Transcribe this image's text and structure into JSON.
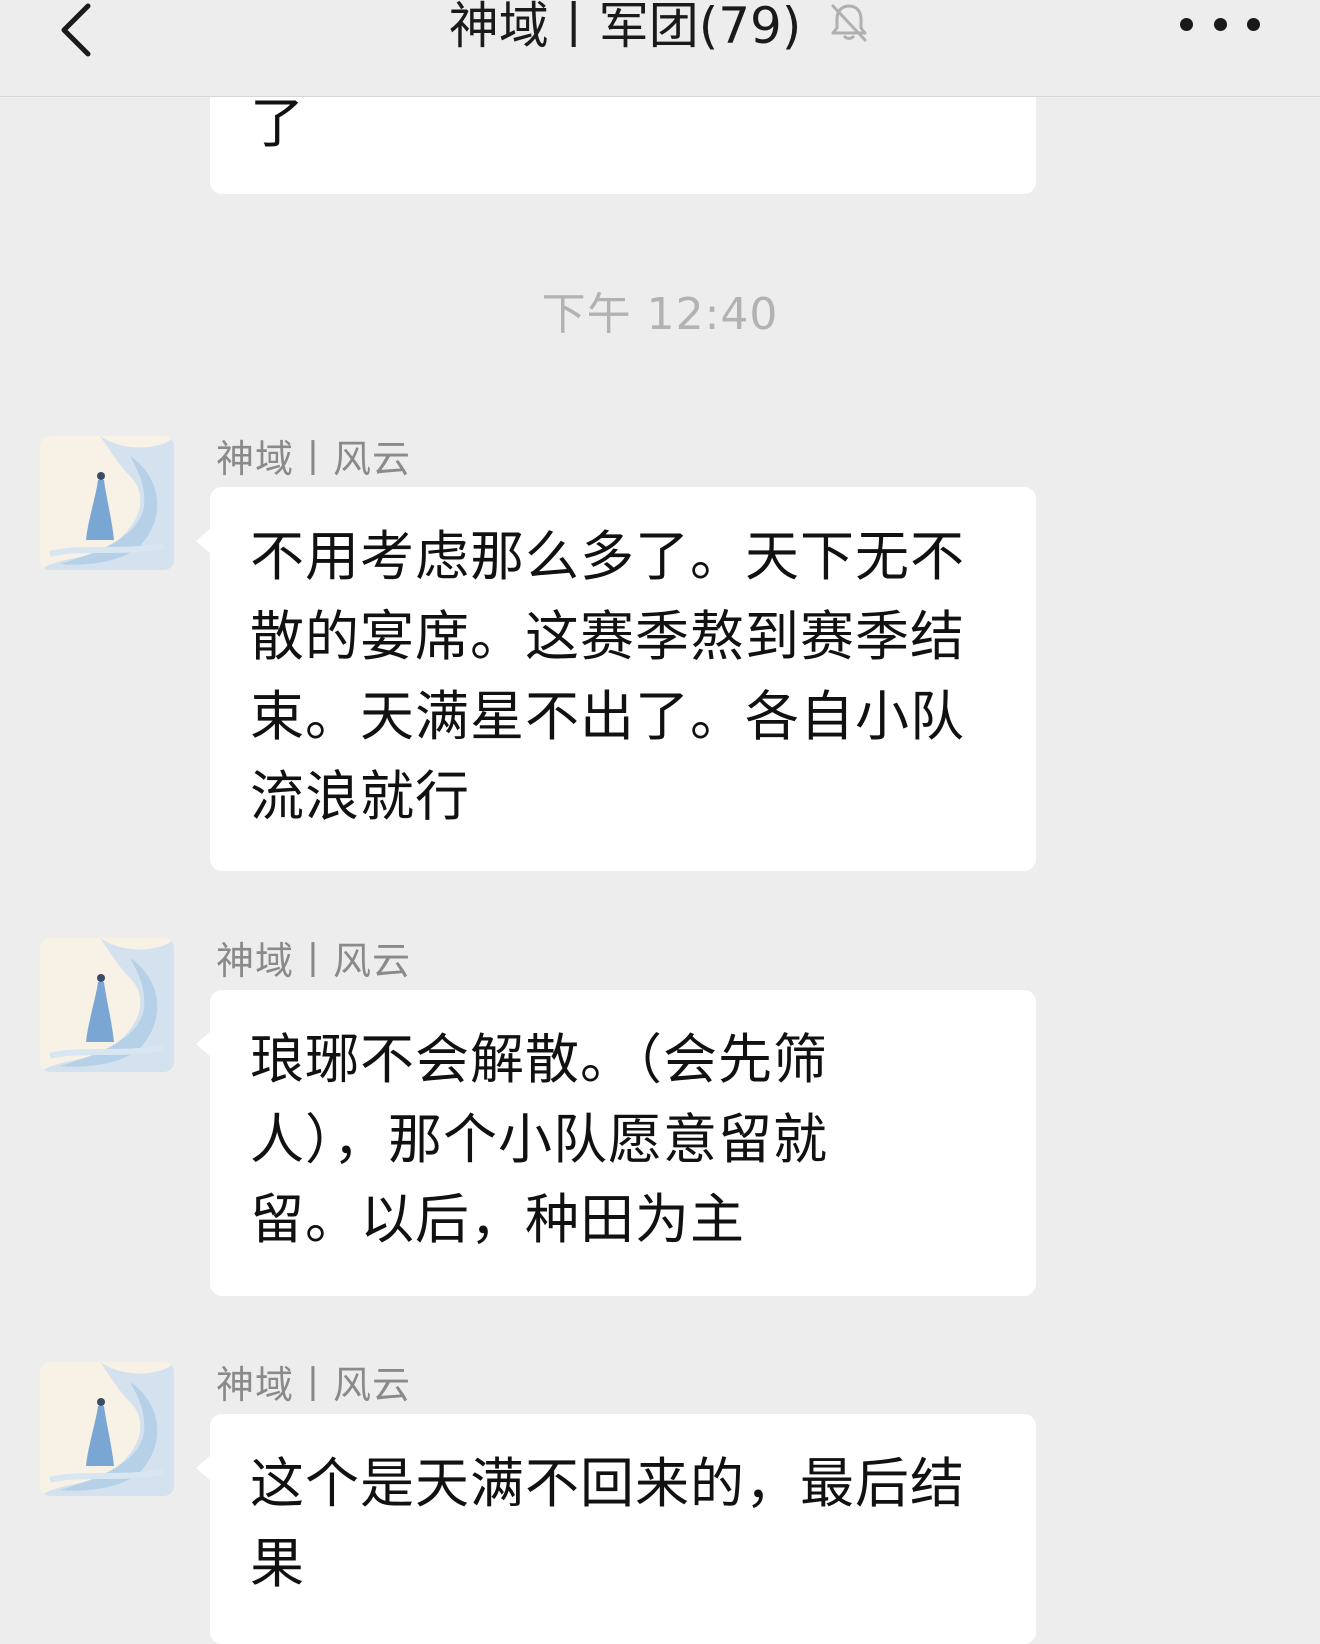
{
  "header": {
    "title": "神域丨军团(79)",
    "back_icon": "chevron-left-icon",
    "mute_icon": "bell-off-icon",
    "more_icon": "ellipsis-icon"
  },
  "messages": [
    {
      "text": "了",
      "partial": true
    },
    {
      "timestamp": "下午 12:40"
    },
    {
      "sender": "神域丨风云",
      "text": "不用考虑那么多了。天下无不散的宴席。这赛季熬到赛季结束。天满星不出了。各自小队流浪就行"
    },
    {
      "sender": "神域丨风云",
      "text": "琅琊不会解散。（会先筛人），那个小队愿意留就留。以后，种田为主"
    },
    {
      "sender": "神域丨风云",
      "text": "这个是天满不回来的，最后结果"
    }
  ]
}
